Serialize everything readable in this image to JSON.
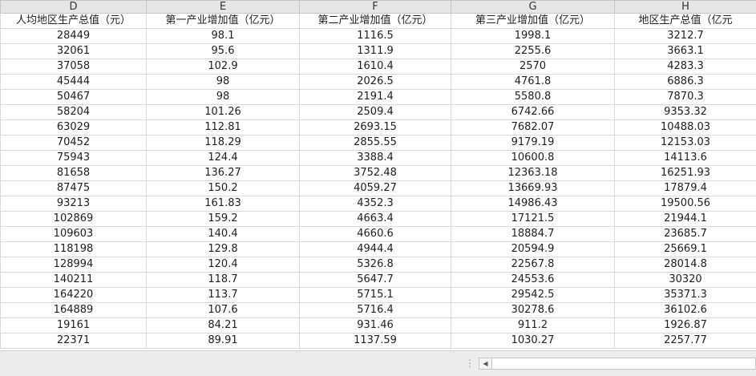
{
  "columns": [
    "D",
    "E",
    "F",
    "G",
    "H"
  ],
  "header_row": [
    "人均地区生产总值（元）",
    "第一产业增加值（亿元）",
    "第二产业增加值（亿元）",
    "第三产业增加值（亿元）",
    "地区生产总值（亿元"
  ],
  "rows": [
    [
      "28449",
      "98.1",
      "1116.5",
      "1998.1",
      "3212.7"
    ],
    [
      "32061",
      "95.6",
      "1311.9",
      "2255.6",
      "3663.1"
    ],
    [
      "37058",
      "102.9",
      "1610.4",
      "2570",
      "4283.3"
    ],
    [
      "45444",
      "98",
      "2026.5",
      "4761.8",
      "6886.3"
    ],
    [
      "50467",
      "98",
      "2191.4",
      "5580.8",
      "7870.3"
    ],
    [
      "58204",
      "101.26",
      "2509.4",
      "6742.66",
      "9353.32"
    ],
    [
      "63029",
      "112.81",
      "2693.15",
      "7682.07",
      "10488.03"
    ],
    [
      "70452",
      "118.29",
      "2855.55",
      "9179.19",
      "12153.03"
    ],
    [
      "75943",
      "124.4",
      "3388.4",
      "10600.8",
      "14113.6"
    ],
    [
      "81658",
      "136.27",
      "3752.48",
      "12363.18",
      "16251.93"
    ],
    [
      "87475",
      "150.2",
      "4059.27",
      "13669.93",
      "17879.4"
    ],
    [
      "93213",
      "161.83",
      "4352.3",
      "14986.43",
      "19500.56"
    ],
    [
      "102869",
      "159.2",
      "4663.4",
      "17121.5",
      "21944.1"
    ],
    [
      "109603",
      "140.4",
      "4660.6",
      "18884.7",
      "23685.7"
    ],
    [
      "118198",
      "129.8",
      "4944.4",
      "20594.9",
      "25669.1"
    ],
    [
      "128994",
      "120.4",
      "5326.8",
      "22567.8",
      "28014.8"
    ],
    [
      "140211",
      "118.7",
      "5647.7",
      "24553.6",
      "30320"
    ],
    [
      "164220",
      "113.7",
      "5715.1",
      "29542.5",
      "35371.3"
    ],
    [
      "164889",
      "107.6",
      "5716.4",
      "30278.6",
      "36102.6"
    ],
    [
      "19161",
      "84.21",
      "931.46",
      "911.2",
      "1926.87"
    ],
    [
      "22371",
      "89.91",
      "1137.59",
      "1030.27",
      "2257.77"
    ]
  ],
  "statusbar": {
    "split_glyph": "⋮",
    "scroll_left_icon": "◀"
  }
}
